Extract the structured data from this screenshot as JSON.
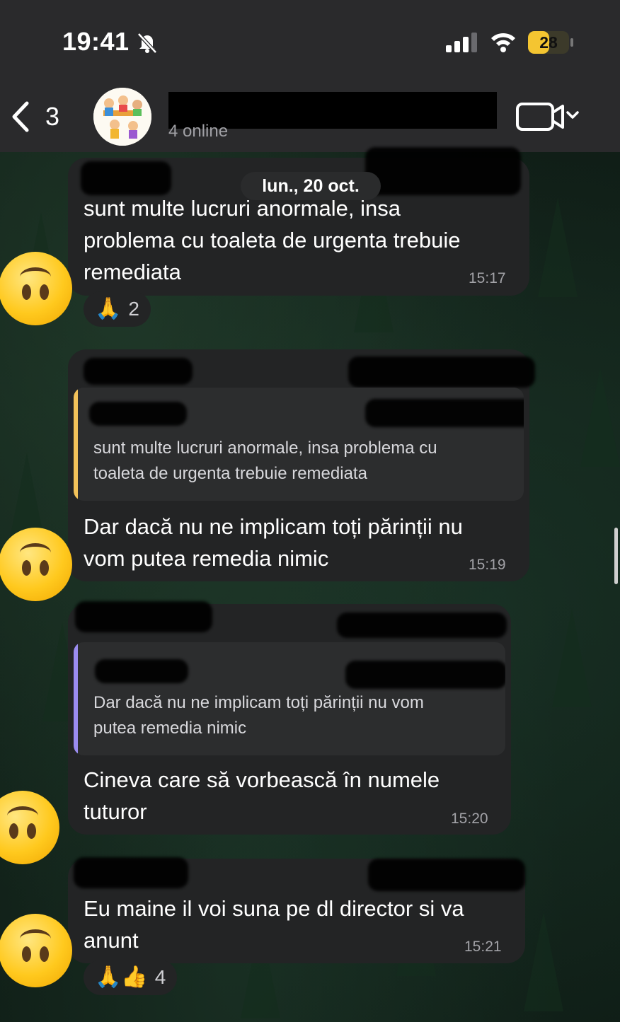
{
  "status_bar": {
    "time": "19:41",
    "battery": "28"
  },
  "header": {
    "back_count": "3",
    "subtitle": "4 online"
  },
  "date_separator": "lun., 20 oct.",
  "messages": [
    {
      "text_lines": [
        "sunt multe lucruri anormale, insa",
        "problema cu toaleta de urgenta trebuie",
        "remediata"
      ],
      "time": "15:17",
      "reactions": {
        "emojis": "🙏",
        "count": "2"
      }
    },
    {
      "quote_lines": [
        "sunt multe lucruri anormale, insa problema cu",
        "toaleta de urgenta trebuie remediata"
      ],
      "quote_color": "#f2c25a",
      "text_lines": [
        "Dar dacă nu ne implicam toți părinții nu",
        "vom putea remedia nimic"
      ],
      "time": "15:19"
    },
    {
      "quote_lines": [
        "Dar dacă nu ne implicam toți părinții nu vom",
        "putea remedia nimic"
      ],
      "quote_color": "#9b8cf0",
      "text_lines": [
        "Cineva care să vorbească în numele",
        "tuturor"
      ],
      "time": "15:20"
    },
    {
      "text_lines": [
        "Eu maine il voi suna pe dl director si va",
        "anunt"
      ],
      "time": "15:21",
      "reactions": {
        "emojis": "🙏👍",
        "count": "4"
      }
    }
  ],
  "icons": [
    "bell-off-icon",
    "signal-icon",
    "wifi-icon",
    "chevron-left-icon",
    "video-camera-icon",
    "chevron-down-icon",
    "upside-down-face-icon"
  ]
}
